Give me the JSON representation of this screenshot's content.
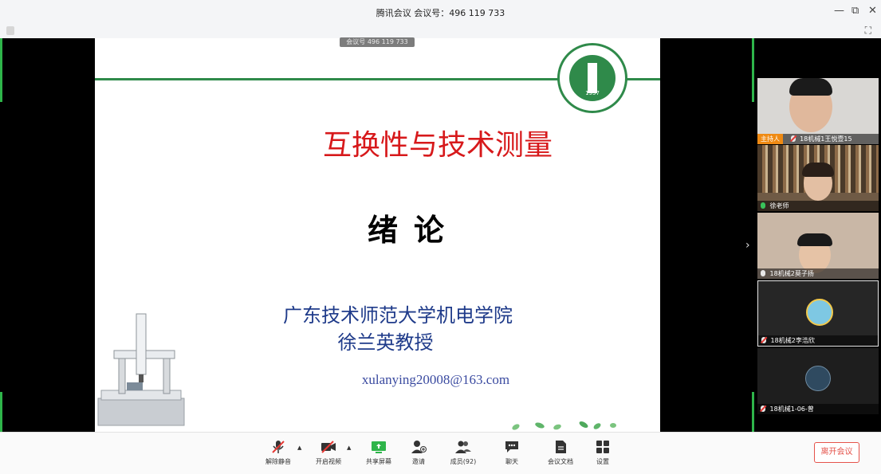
{
  "window": {
    "title": "腾讯会议 会议号：496 119 733",
    "minimize": "—",
    "restore": "⧉",
    "close": "✕"
  },
  "meeting_tag": "会议号 496 119 733",
  "slide": {
    "title": "互换性与技术测量",
    "subtitle": "绪论",
    "institution": "广东技术师范大学机电学院",
    "professor": "徐兰英教授",
    "email": "xulanying20008@163.com",
    "logo_year": "1957"
  },
  "participants": [
    {
      "name": "18机械1王悦壹15",
      "role": "主持人",
      "mic": "muted"
    },
    {
      "name": "徐老师",
      "mic": "on"
    },
    {
      "name": "18机械2莫子扬",
      "mic": "on"
    },
    {
      "name": "18机械2李浩欣",
      "mic": "muted"
    },
    {
      "name": "18机械1-06-曾",
      "mic": "muted"
    }
  ],
  "toolbar": {
    "mute_label": "解除静音",
    "video_label": "开启视频",
    "share_label": "共享屏幕",
    "invite_label": "邀请",
    "members_label": "成员(92)",
    "chat_label": "聊天",
    "docs_label": "会议文档",
    "settings_label": "设置",
    "leave_label": "离开会议"
  },
  "colors": {
    "accent_green": "#2eb54a",
    "slide_title_red": "#d7191b",
    "slide_text_blue": "#1f3b8a",
    "host_badge": "#ef8a13",
    "leave_red": "#e5534b"
  }
}
